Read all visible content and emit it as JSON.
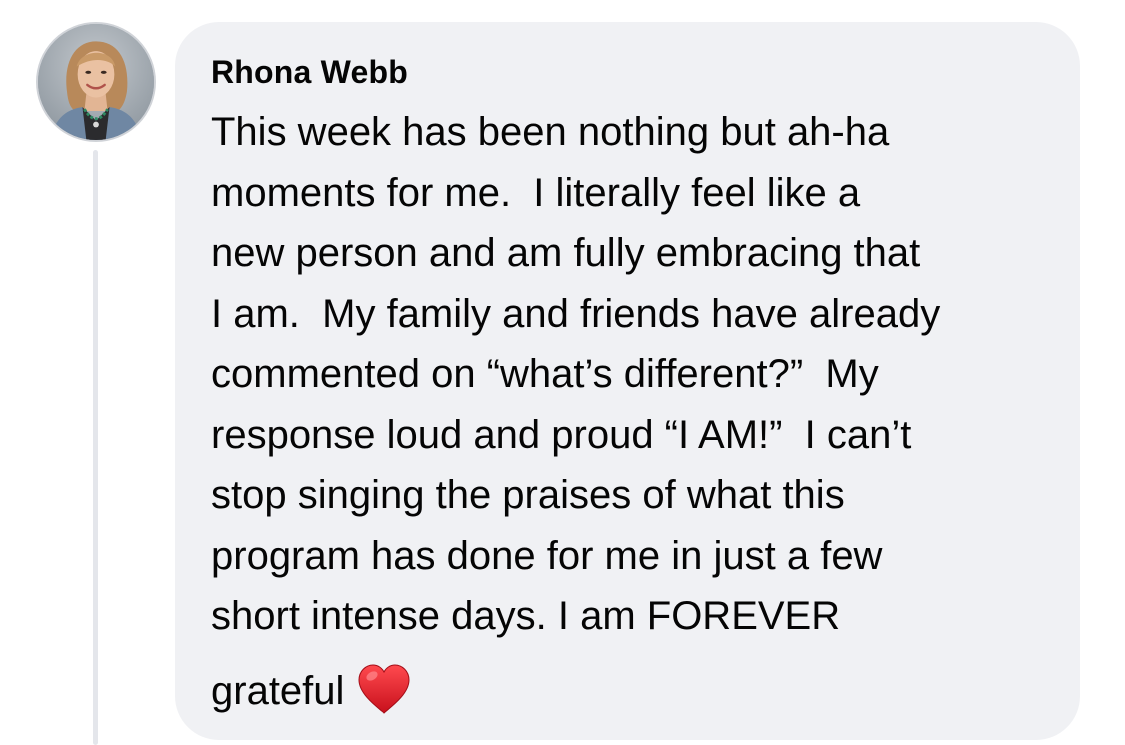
{
  "comment": {
    "author": "Rhona Webb",
    "lines": [
      "This week has been nothing but ah-ha",
      "moments for me.  I literally feel like a",
      "new person and am fully embracing that",
      "I am.  My family and friends have already",
      "commented on “what’s different?”  My",
      "response loud and proud “I AM!”  I can’t",
      "stop singing the praises of what this",
      "program has done for me in just a few",
      "short intense days. I am FOREVER",
      "grateful"
    ],
    "emoji": "heart-icon",
    "colors": {
      "bubble": "#f0f1f4",
      "text": "#050505",
      "heart": "#e0212e",
      "thread_line": "#e4e6eb"
    }
  }
}
